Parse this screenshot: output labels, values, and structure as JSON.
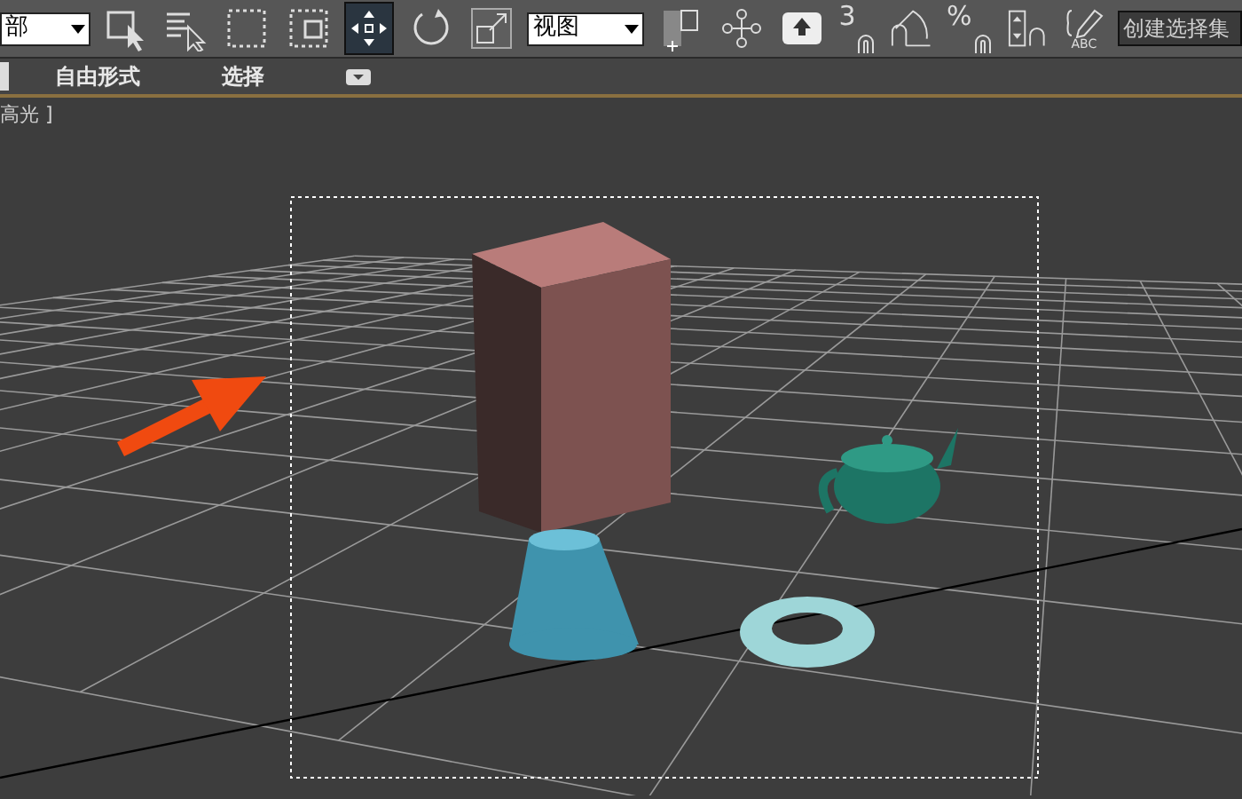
{
  "toolbar": {
    "selection_filter": {
      "value": "部"
    },
    "tools_left": [
      {
        "kind": "select-object",
        "selected": false
      },
      {
        "kind": "select-by-name",
        "selected": false
      },
      {
        "kind": "rect-region",
        "selected": false
      },
      {
        "kind": "window-crossing",
        "selected": false
      },
      {
        "kind": "move",
        "selected": true
      },
      {
        "kind": "rotate",
        "selected": false
      },
      {
        "kind": "scale",
        "selected": false
      }
    ],
    "reference_coord": {
      "value": "视图"
    },
    "tools_right": [
      {
        "kind": "pivot",
        "selected": false
      },
      {
        "kind": "manipulate",
        "selected": false
      },
      {
        "kind": "keyboard-shortcut",
        "selected": false
      }
    ],
    "snap_label": "3",
    "percent_label": "%",
    "abc_label": "ABC",
    "named_selection": {
      "placeholder": "创建选择集"
    }
  },
  "ribbon_tabs": [
    {
      "label": "自由形式"
    },
    {
      "label": "选择"
    }
  ],
  "viewport": {
    "label": "高光 ]"
  }
}
